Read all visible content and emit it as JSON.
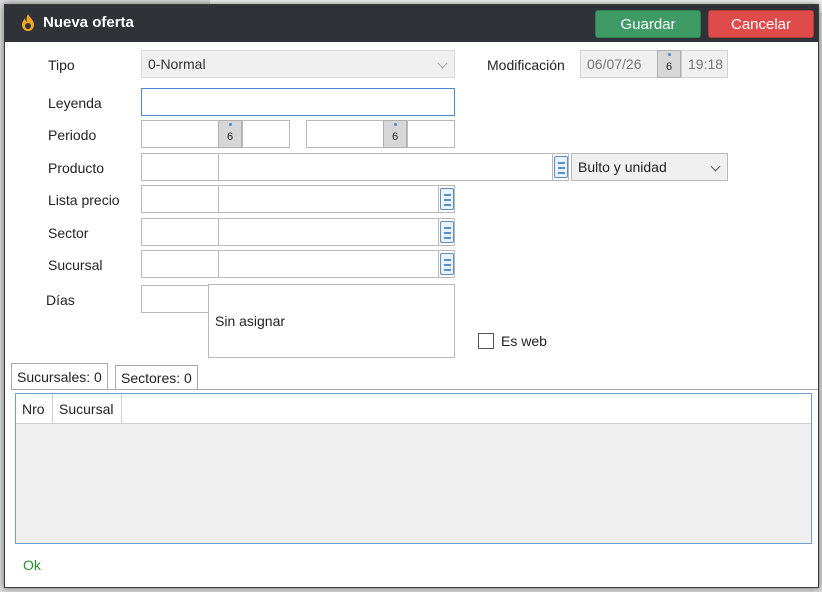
{
  "window": {
    "title": "Nueva oferta",
    "save_label": "Guardar",
    "cancel_label": "Cancelar",
    "colors": {
      "save": "#3e9b66",
      "cancel": "#df4b4b",
      "titlebar": "#2f3236",
      "status_ok": "#2e8b2e"
    }
  },
  "form": {
    "tipo": {
      "label": "Tipo",
      "value": "0-Normal"
    },
    "modificacion": {
      "label": "Modificación",
      "date": "06/07/26",
      "day_icon": "6",
      "time": "19:18"
    },
    "leyenda": {
      "label": "Leyenda",
      "value": ""
    },
    "periodo": {
      "label": "Periodo",
      "from_date": "",
      "from_day_icon": "6",
      "from_time": "",
      "to_date": "",
      "to_day_icon": "6",
      "to_time": ""
    },
    "producto": {
      "label": "Producto",
      "code": "",
      "name": "",
      "unit_select": "Bulto y unidad"
    },
    "lista_precio": {
      "label": "Lista precio",
      "code": "",
      "name": ""
    },
    "sector": {
      "label": "Sector",
      "code": "",
      "name": ""
    },
    "sucursal": {
      "label": "Sucursal",
      "code": "",
      "name": ""
    },
    "dias": {
      "label": "Días",
      "value": "",
      "summary": "Sin asignar"
    },
    "es_web": {
      "label": "Es web",
      "checked": false
    }
  },
  "tabs": [
    {
      "label": "Sucursales: 0",
      "active": true
    },
    {
      "label": "Sectores: 0",
      "active": false
    }
  ],
  "grid": {
    "columns": [
      "Nro",
      "Sucursal"
    ],
    "rows": []
  },
  "status": {
    "text": "Ok"
  },
  "icons": {
    "title": "flame-icon",
    "calendar": "calendar-icon",
    "lookup": "list-lookup-icon",
    "dropdown": "chevron-down-icon"
  }
}
